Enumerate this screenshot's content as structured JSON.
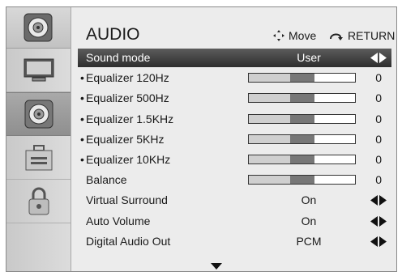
{
  "header": {
    "title": "AUDIO",
    "move_label": "Move",
    "return_label": "RETURN"
  },
  "sidebar": {
    "items": [
      {
        "icon": "picture-icon",
        "label": ""
      },
      {
        "icon": "speaker-icon",
        "label": ""
      },
      {
        "icon": "toolbox-icon",
        "label": ""
      },
      {
        "icon": "lock-icon",
        "label": ""
      }
    ],
    "active_index": 1
  },
  "menu": {
    "selected_index": 0,
    "rows": [
      {
        "label": "Sound mode",
        "type": "option",
        "value": "User"
      },
      {
        "label": "Equalizer 120Hz",
        "type": "slider",
        "value": "0",
        "level": 0.5
      },
      {
        "label": "Equalizer 500Hz",
        "type": "slider",
        "value": "0",
        "level": 0.5
      },
      {
        "label": "Equalizer 1.5KHz",
        "type": "slider",
        "value": "0",
        "level": 0.5
      },
      {
        "label": "Equalizer 5KHz",
        "type": "slider",
        "value": "0",
        "level": 0.5
      },
      {
        "label": "Equalizer 10KHz",
        "type": "slider",
        "value": "0",
        "level": 0.5
      },
      {
        "label": "Balance",
        "type": "slider",
        "value": "0",
        "level": 0.5
      },
      {
        "label": "Virtual Surround",
        "type": "option",
        "value": "On"
      },
      {
        "label": "Auto Volume",
        "type": "option",
        "value": "On"
      },
      {
        "label": "Digital Audio Out",
        "type": "option",
        "value": "PCM"
      }
    ]
  },
  "colors": {
    "highlight": "#3a3a3a",
    "background": "#ececec"
  }
}
